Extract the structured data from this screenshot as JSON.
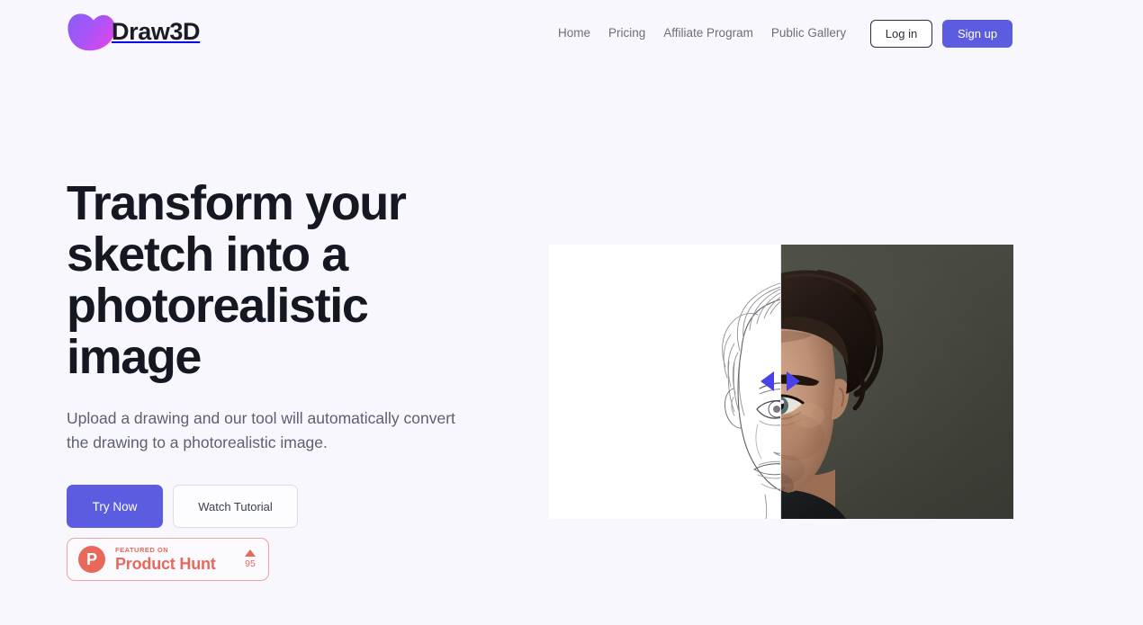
{
  "brand": {
    "name": "Draw3D",
    "logo_icon": "blob-heart-logo-icon",
    "gradient_from": "#8b5cf6",
    "gradient_to": "#d946ef"
  },
  "nav": {
    "items": [
      {
        "label": "Home"
      },
      {
        "label": "Pricing"
      },
      {
        "label": "Affiliate Program"
      },
      {
        "label": "Public Gallery"
      }
    ],
    "login_label": "Log in",
    "signup_label": "Sign up",
    "link_color": "#6b6f7b",
    "accent_color": "#5c5ce0"
  },
  "hero": {
    "headline": "Transform your sketch into a photorealistic image",
    "subhead": "Upload a drawing and our tool will automatically convert the drawing to a photorealistic image.",
    "primary_cta": "Try Now",
    "secondary_cta": "Watch Tutorial",
    "primary_color": "#5c5ce0"
  },
  "product_hunt": {
    "featured_label": "FEATURED ON",
    "name": "Product Hunt",
    "logo_letter": "P",
    "upvote_icon": "upvote-triangle-icon",
    "upvote_count": "95",
    "brand_color": "#e8685a"
  },
  "compare": {
    "before_alt": "pencil sketch of a young man's face",
    "after_alt": "photorealistic portrait of a young man",
    "handle_icon": "compare-slider-handle-icon",
    "handle_color": "#4a42e8",
    "split_percent": "50"
  }
}
